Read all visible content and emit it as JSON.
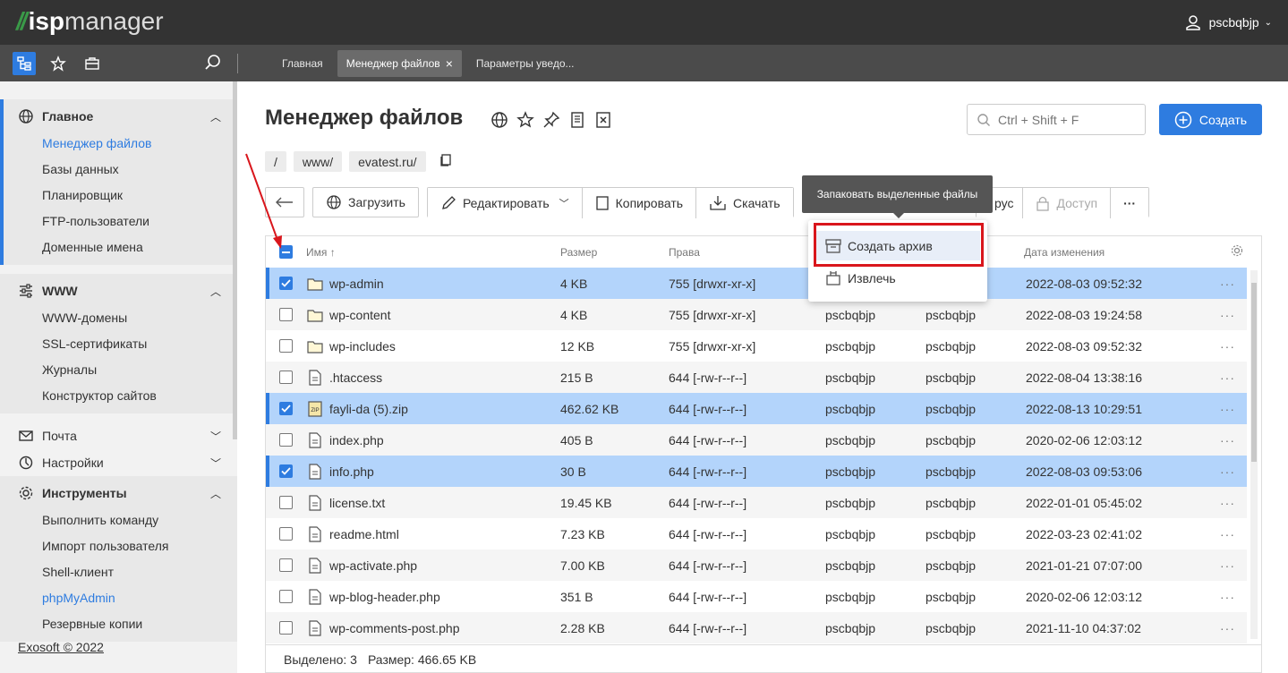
{
  "header": {
    "logo_prefix": "//",
    "logo_isp": "isp",
    "logo_manager": "manager",
    "username": "pscbqbjp"
  },
  "tabs": [
    {
      "label": "Главная",
      "active": false
    },
    {
      "label": "Менеджер файлов",
      "active": true
    },
    {
      "label": "Параметры уведо...",
      "active": false
    }
  ],
  "sidebar": {
    "main": {
      "title": "Главное",
      "items": [
        "Менеджер файлов",
        "Базы данных",
        "Планировщик",
        "FTP-пользователи",
        "Доменные имена"
      ]
    },
    "www": {
      "title": "WWW",
      "items": [
        "WWW-домены",
        "SSL-сертификаты",
        "Журналы",
        "Конструктор сайтов"
      ]
    },
    "mail": "Почта",
    "settings": "Настройки",
    "tools": {
      "title": "Инструменты",
      "items": [
        "Выполнить команду",
        "Импорт пользователя",
        "Shell-клиент",
        "phpMyAdmin",
        "Резервные копии"
      ]
    },
    "copyright": "Exosoft © 2022"
  },
  "page": {
    "title": "Менеджер файлов",
    "search_placeholder": "Ctrl + Shift + F",
    "create_label": "Создать",
    "breadcrumbs": [
      "/",
      "www/",
      "evatest.ru/"
    ]
  },
  "toolbar": {
    "upload": "Загрузить",
    "edit": "Редактировать",
    "copy": "Копировать",
    "download": "Скачать",
    "partial_hidden": "рус",
    "access": "Доступ",
    "more": "···"
  },
  "table": {
    "columns": {
      "name": "Имя ↑",
      "size": "Размер",
      "perms": "Права",
      "modified": "Дата изменения"
    },
    "rows": [
      {
        "name": "wp-admin",
        "type": "folder",
        "size": "4 KB",
        "perms": "755 [drwxr-xr-x]",
        "owner": "pscbqbjp",
        "group": "pscbqbjp",
        "date": "2022-08-03 09:52:32",
        "checked": true
      },
      {
        "name": "wp-content",
        "type": "folder",
        "size": "4 KB",
        "perms": "755 [drwxr-xr-x]",
        "owner": "pscbqbjp",
        "group": "pscbqbjp",
        "date": "2022-08-03 19:24:58",
        "checked": false
      },
      {
        "name": "wp-includes",
        "type": "folder",
        "size": "12 KB",
        "perms": "755 [drwxr-xr-x]",
        "owner": "pscbqbjp",
        "group": "pscbqbjp",
        "date": "2022-08-03 09:52:32",
        "checked": false
      },
      {
        "name": ".htaccess",
        "type": "file",
        "size": "215 B",
        "perms": "644 [-rw-r--r--]",
        "owner": "pscbqbjp",
        "group": "pscbqbjp",
        "date": "2022-08-04 13:38:16",
        "checked": false
      },
      {
        "name": "fayli-da (5).zip",
        "type": "zip",
        "size": "462.62 KB",
        "perms": "644 [-rw-r--r--]",
        "owner": "pscbqbjp",
        "group": "pscbqbjp",
        "date": "2022-08-13 10:29:51",
        "checked": true
      },
      {
        "name": "index.php",
        "type": "file",
        "size": "405 B",
        "perms": "644 [-rw-r--r--]",
        "owner": "pscbqbjp",
        "group": "pscbqbjp",
        "date": "2020-02-06 12:03:12",
        "checked": false
      },
      {
        "name": "info.php",
        "type": "file",
        "size": "30 B",
        "perms": "644 [-rw-r--r--]",
        "owner": "pscbqbjp",
        "group": "pscbqbjp",
        "date": "2022-08-03 09:53:06",
        "checked": true
      },
      {
        "name": "license.txt",
        "type": "file",
        "size": "19.45 KB",
        "perms": "644 [-rw-r--r--]",
        "owner": "pscbqbjp",
        "group": "pscbqbjp",
        "date": "2022-01-01 05:45:02",
        "checked": false
      },
      {
        "name": "readme.html",
        "type": "file",
        "size": "7.23 KB",
        "perms": "644 [-rw-r--r--]",
        "owner": "pscbqbjp",
        "group": "pscbqbjp",
        "date": "2022-03-23 02:41:02",
        "checked": false
      },
      {
        "name": "wp-activate.php",
        "type": "file",
        "size": "7.00 KB",
        "perms": "644 [-rw-r--r--]",
        "owner": "pscbqbjp",
        "group": "pscbqbjp",
        "date": "2021-01-21 07:07:00",
        "checked": false
      },
      {
        "name": "wp-blog-header.php",
        "type": "file",
        "size": "351 B",
        "perms": "644 [-rw-r--r--]",
        "owner": "pscbqbjp",
        "group": "pscbqbjp",
        "date": "2020-02-06 12:03:12",
        "checked": false
      },
      {
        "name": "wp-comments-post.php",
        "type": "file",
        "size": "2.28 KB",
        "perms": "644 [-rw-r--r--]",
        "owner": "pscbqbjp",
        "group": "pscbqbjp",
        "date": "2021-11-10 04:37:02",
        "checked": false
      }
    ],
    "footer": {
      "selected": "Выделено: 3",
      "size": "Размер: 466.65 KB"
    }
  },
  "tooltip": "Запаковать выделенные файлы",
  "menu": {
    "create_archive": "Создать архив",
    "extract": "Извлечь"
  },
  "colors": {
    "accent": "#2e7ce0",
    "highlight_row": "#b3d4fb",
    "annotation_red": "#d9161c"
  }
}
